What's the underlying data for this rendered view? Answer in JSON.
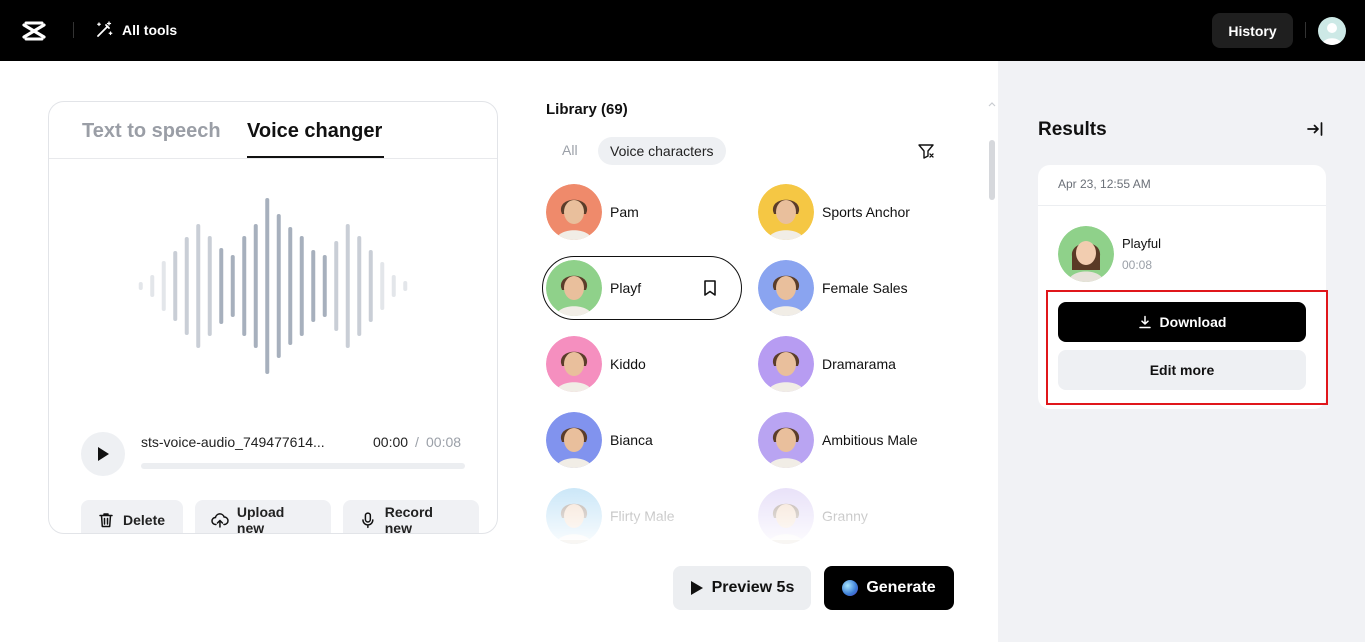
{
  "topbar": {
    "all_tools_label": "All tools",
    "history_label": "History"
  },
  "left_card": {
    "tabs": [
      {
        "label": "Text to speech",
        "active": false
      },
      {
        "label": "Voice changer",
        "active": true
      }
    ],
    "audio": {
      "file_name": "sts-voice-audio_749477614...",
      "current_time": "00:00",
      "separator": "/",
      "total_time": "00:08",
      "progress": 0
    },
    "actions": {
      "delete_label": "Delete",
      "upload_label": "Upload new",
      "record_label": "Record new"
    }
  },
  "library": {
    "title": "Library (69)",
    "filters": [
      {
        "label": "All",
        "active": false
      },
      {
        "label": "Voice characters",
        "active": true
      }
    ],
    "voices": [
      {
        "name": "Pam",
        "color": "#ef8a6b"
      },
      {
        "name": "Sports Anchor",
        "color": "#f5c744"
      },
      {
        "name": "Playf",
        "color": "#8fd18a",
        "selected": true
      },
      {
        "name": "Female Sales",
        "color": "#8aa4f0"
      },
      {
        "name": "Kiddo",
        "color": "#f58fbf"
      },
      {
        "name": "Dramarama",
        "color": "#b79cf2"
      },
      {
        "name": "Bianca",
        "color": "#8193ee"
      },
      {
        "name": "Ambitious Male",
        "color": "#b9a4f2"
      },
      {
        "name": "Flirty Male",
        "color": "#7fc4ee"
      },
      {
        "name": "Granny",
        "color": "#c9b8f0"
      }
    ],
    "preview_label": "Preview 5s",
    "generate_label": "Generate"
  },
  "results": {
    "title": "Results",
    "date": "Apr 23, 12:55 AM",
    "voice_name": "Playful",
    "duration": "00:08",
    "download_label": "Download",
    "edit_label": "Edit more",
    "highlight_color": "#e0161b"
  }
}
